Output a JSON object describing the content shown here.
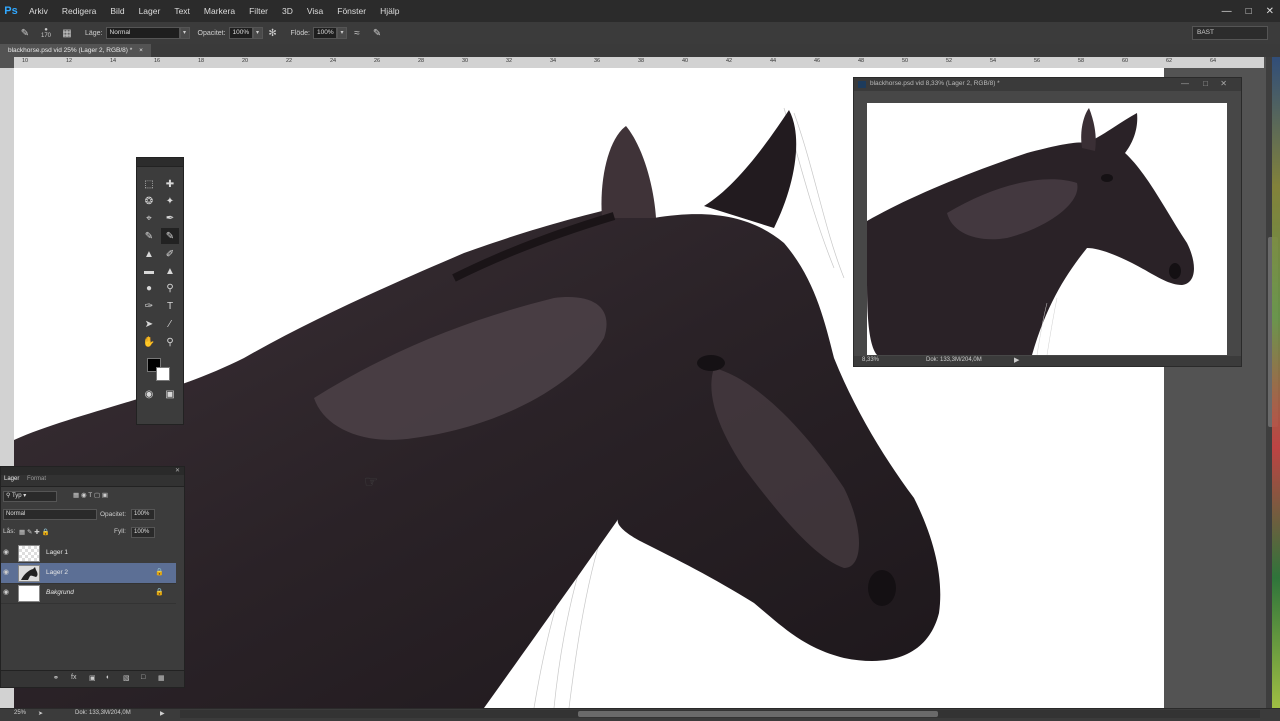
{
  "app": {
    "logo": "Ps"
  },
  "menu": [
    "Arkiv",
    "Redigera",
    "Bild",
    "Lager",
    "Text",
    "Markera",
    "Filter",
    "3D",
    "Visa",
    "Fönster",
    "Hjälp"
  ],
  "window_controls": [
    "minimize-icon",
    "restore-icon",
    "close-icon"
  ],
  "options": {
    "brush_size": "170",
    "mode_label": "Läge:",
    "mode_value": "Normal",
    "opacity_label": "Opacitet:",
    "opacity_value": "100%",
    "flow_label": "Flöde:",
    "flow_value": "100%",
    "workspace": "BAST"
  },
  "document_tab": {
    "title": "blackhorse.psd vid 25% (Lager 2, RGB/8) *",
    "close": "×"
  },
  "ruler_h_labels": [
    "10",
    "12",
    "14",
    "16",
    "18",
    "20",
    "22",
    "24",
    "26",
    "28",
    "30",
    "32",
    "34",
    "36",
    "38",
    "40",
    "42",
    "44",
    "46",
    "48",
    "50",
    "52",
    "54",
    "56",
    "58",
    "60",
    "62",
    "64"
  ],
  "tools_panel": {
    "icons": [
      "marquee-icon",
      "move-icon",
      "lasso-icon",
      "quick-select-icon",
      "crop-icon",
      "eyedropper-icon",
      "healing-icon",
      "brush-icon",
      "stamp-icon",
      "history-brush-icon",
      "eraser-icon",
      "paint-bucket-icon",
      "dodge-icon",
      "zoom-icon",
      "pen-icon",
      "type-icon",
      "path-select-icon",
      "line-icon",
      "hand-icon",
      "zoom-icon-2",
      "quickmask-icon",
      "screen-mode-icon"
    ],
    "foreground_color": "#000000",
    "background_color": "#ffffff"
  },
  "layers_panel": {
    "tabs": [
      "Lager",
      "Format"
    ],
    "filter_kind": "Typ",
    "blend_mode": "Normal",
    "opacity_label": "Opacitet:",
    "opacity_value": "100%",
    "lock_label": "Lås:",
    "fill_label": "Fyll:",
    "fill_value": "100%",
    "layers": [
      {
        "name": "Lager 1",
        "selected": false,
        "locked": false
      },
      {
        "name": "Lager 2",
        "selected": true,
        "locked": true
      },
      {
        "name": "Bakgrund",
        "selected": false,
        "locked": true
      }
    ]
  },
  "nav_window": {
    "title": "blackhorse.psd vid 8,33% (Lager 2, RGB/8) *",
    "zoom": "8,33%",
    "doc_info": "Dok: 133,3M/204,0M"
  },
  "status": {
    "zoom": "25%",
    "doc_info": "Dok: 133,3M/204,0M"
  },
  "colors": {
    "horse": "#2a2227",
    "horse_highlight": "#5a4c54",
    "ui_dark": "#2b2b2b",
    "selected_layer": "#5c6f95"
  }
}
